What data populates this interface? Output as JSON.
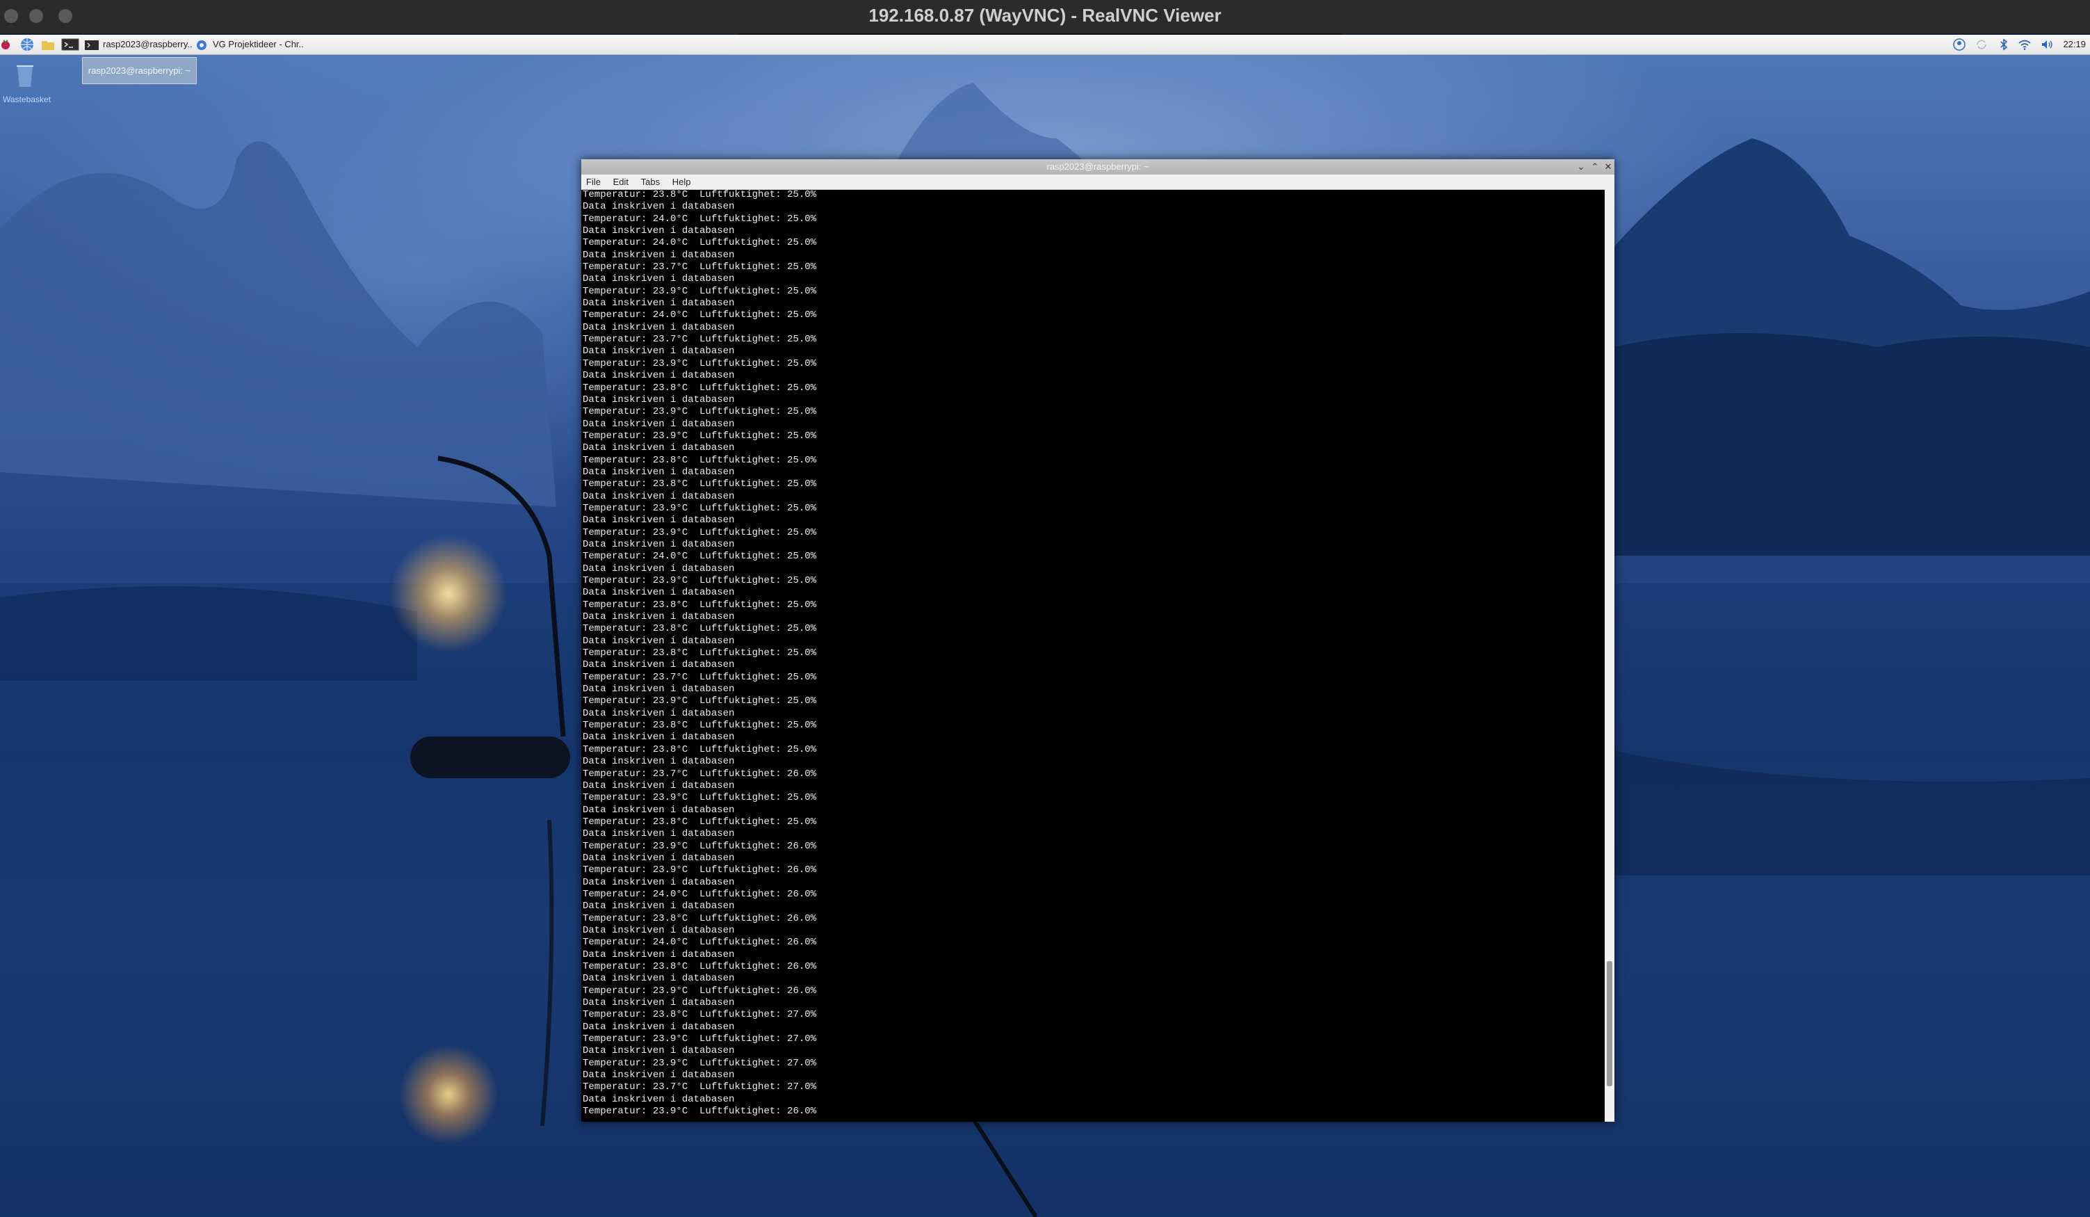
{
  "mac_window": {
    "title": "192.168.0.87 (WayVNC) - RealVNC Viewer"
  },
  "taskbar": {
    "launchers": [
      "raspberry-menu-icon",
      "browser-icon",
      "file-manager-icon",
      "terminal-icon"
    ],
    "tasks": [
      {
        "label": "rasp2023@raspberry..",
        "icon": "terminal-icon"
      },
      {
        "label": "VG Projektideer - Chr..",
        "icon": "chromium-icon"
      }
    ],
    "tray": [
      "user-icon",
      "sync-icon",
      "bluetooth-icon",
      "wifi-icon",
      "volume-icon"
    ],
    "clock": "22:19"
  },
  "desktop": {
    "icons": [
      {
        "label": "Wastebasket",
        "icon": "wastebasket-icon"
      }
    ],
    "tooltip": "rasp2023@raspberrypi: ~"
  },
  "terminal": {
    "title": "rasp2023@raspberrypi: ~",
    "menu": [
      "File",
      "Edit",
      "Tabs",
      "Help"
    ],
    "lines": [
      "Temperatur: 23.8°C  Luftfuktighet: 25.0%",
      "Data inskriven i databasen",
      "Temperatur: 24.0°C  Luftfuktighet: 25.0%",
      "Data inskriven i databasen",
      "Temperatur: 24.0°C  Luftfuktighet: 25.0%",
      "Data inskriven i databasen",
      "Temperatur: 23.7°C  Luftfuktighet: 25.0%",
      "Data inskriven i databasen",
      "Temperatur: 23.9°C  Luftfuktighet: 25.0%",
      "Data inskriven i databasen",
      "Temperatur: 24.0°C  Luftfuktighet: 25.0%",
      "Data inskriven i databasen",
      "Temperatur: 23.7°C  Luftfuktighet: 25.0%",
      "Data inskriven i databasen",
      "Temperatur: 23.9°C  Luftfuktighet: 25.0%",
      "Data inskriven i databasen",
      "Temperatur: 23.8°C  Luftfuktighet: 25.0%",
      "Data inskriven i databasen",
      "Temperatur: 23.9°C  Luftfuktighet: 25.0%",
      "Data inskriven i databasen",
      "Temperatur: 23.9°C  Luftfuktighet: 25.0%",
      "Data inskriven i databasen",
      "Temperatur: 23.8°C  Luftfuktighet: 25.0%",
      "Data inskriven i databasen",
      "Temperatur: 23.8°C  Luftfuktighet: 25.0%",
      "Data inskriven i databasen",
      "Temperatur: 23.9°C  Luftfuktighet: 25.0%",
      "Data inskriven i databasen",
      "Temperatur: 23.9°C  Luftfuktighet: 25.0%",
      "Data inskriven i databasen",
      "Temperatur: 24.0°C  Luftfuktighet: 25.0%",
      "Data inskriven i databasen",
      "Temperatur: 23.9°C  Luftfuktighet: 25.0%",
      "Data inskriven i databasen",
      "Temperatur: 23.8°C  Luftfuktighet: 25.0%",
      "Data inskriven i databasen",
      "Temperatur: 23.8°C  Luftfuktighet: 25.0%",
      "Data inskriven i databasen",
      "Temperatur: 23.8°C  Luftfuktighet: 25.0%",
      "Data inskriven i databasen",
      "Temperatur: 23.7°C  Luftfuktighet: 25.0%",
      "Data inskriven i databasen",
      "Temperatur: 23.9°C  Luftfuktighet: 25.0%",
      "Data inskriven i databasen",
      "Temperatur: 23.8°C  Luftfuktighet: 25.0%",
      "Data inskriven i databasen",
      "Temperatur: 23.8°C  Luftfuktighet: 25.0%",
      "Data inskriven i databasen",
      "Temperatur: 23.7°C  Luftfuktighet: 26.0%",
      "Data inskriven i databasen",
      "Temperatur: 23.9°C  Luftfuktighet: 25.0%",
      "Data inskriven i databasen",
      "Temperatur: 23.8°C  Luftfuktighet: 25.0%",
      "Data inskriven i databasen",
      "Temperatur: 23.9°C  Luftfuktighet: 26.0%",
      "Data inskriven i databasen",
      "Temperatur: 23.9°C  Luftfuktighet: 26.0%",
      "Data inskriven i databasen",
      "Temperatur: 24.0°C  Luftfuktighet: 26.0%",
      "Data inskriven i databasen",
      "Temperatur: 23.8°C  Luftfuktighet: 26.0%",
      "Data inskriven i databasen",
      "Temperatur: 24.0°C  Luftfuktighet: 26.0%",
      "Data inskriven i databasen",
      "Temperatur: 23.8°C  Luftfuktighet: 26.0%",
      "Data inskriven i databasen",
      "Temperatur: 23.9°C  Luftfuktighet: 26.0%",
      "Data inskriven i databasen",
      "Temperatur: 23.8°C  Luftfuktighet: 27.0%",
      "Data inskriven i databasen",
      "Temperatur: 23.9°C  Luftfuktighet: 27.0%",
      "Data inskriven i databasen",
      "Temperatur: 23.9°C  Luftfuktighet: 27.0%",
      "Data inskriven i databasen",
      "Temperatur: 23.7°C  Luftfuktighet: 27.0%",
      "Data inskriven i databasen",
      "Temperatur: 23.9°C  Luftfuktighet: 26.0%"
    ]
  },
  "colors": {
    "terminal_bg": "#000000",
    "terminal_fg": "#ececec",
    "desktop_blue": "#1f3f7c",
    "lantern": "#ffcf7a"
  }
}
